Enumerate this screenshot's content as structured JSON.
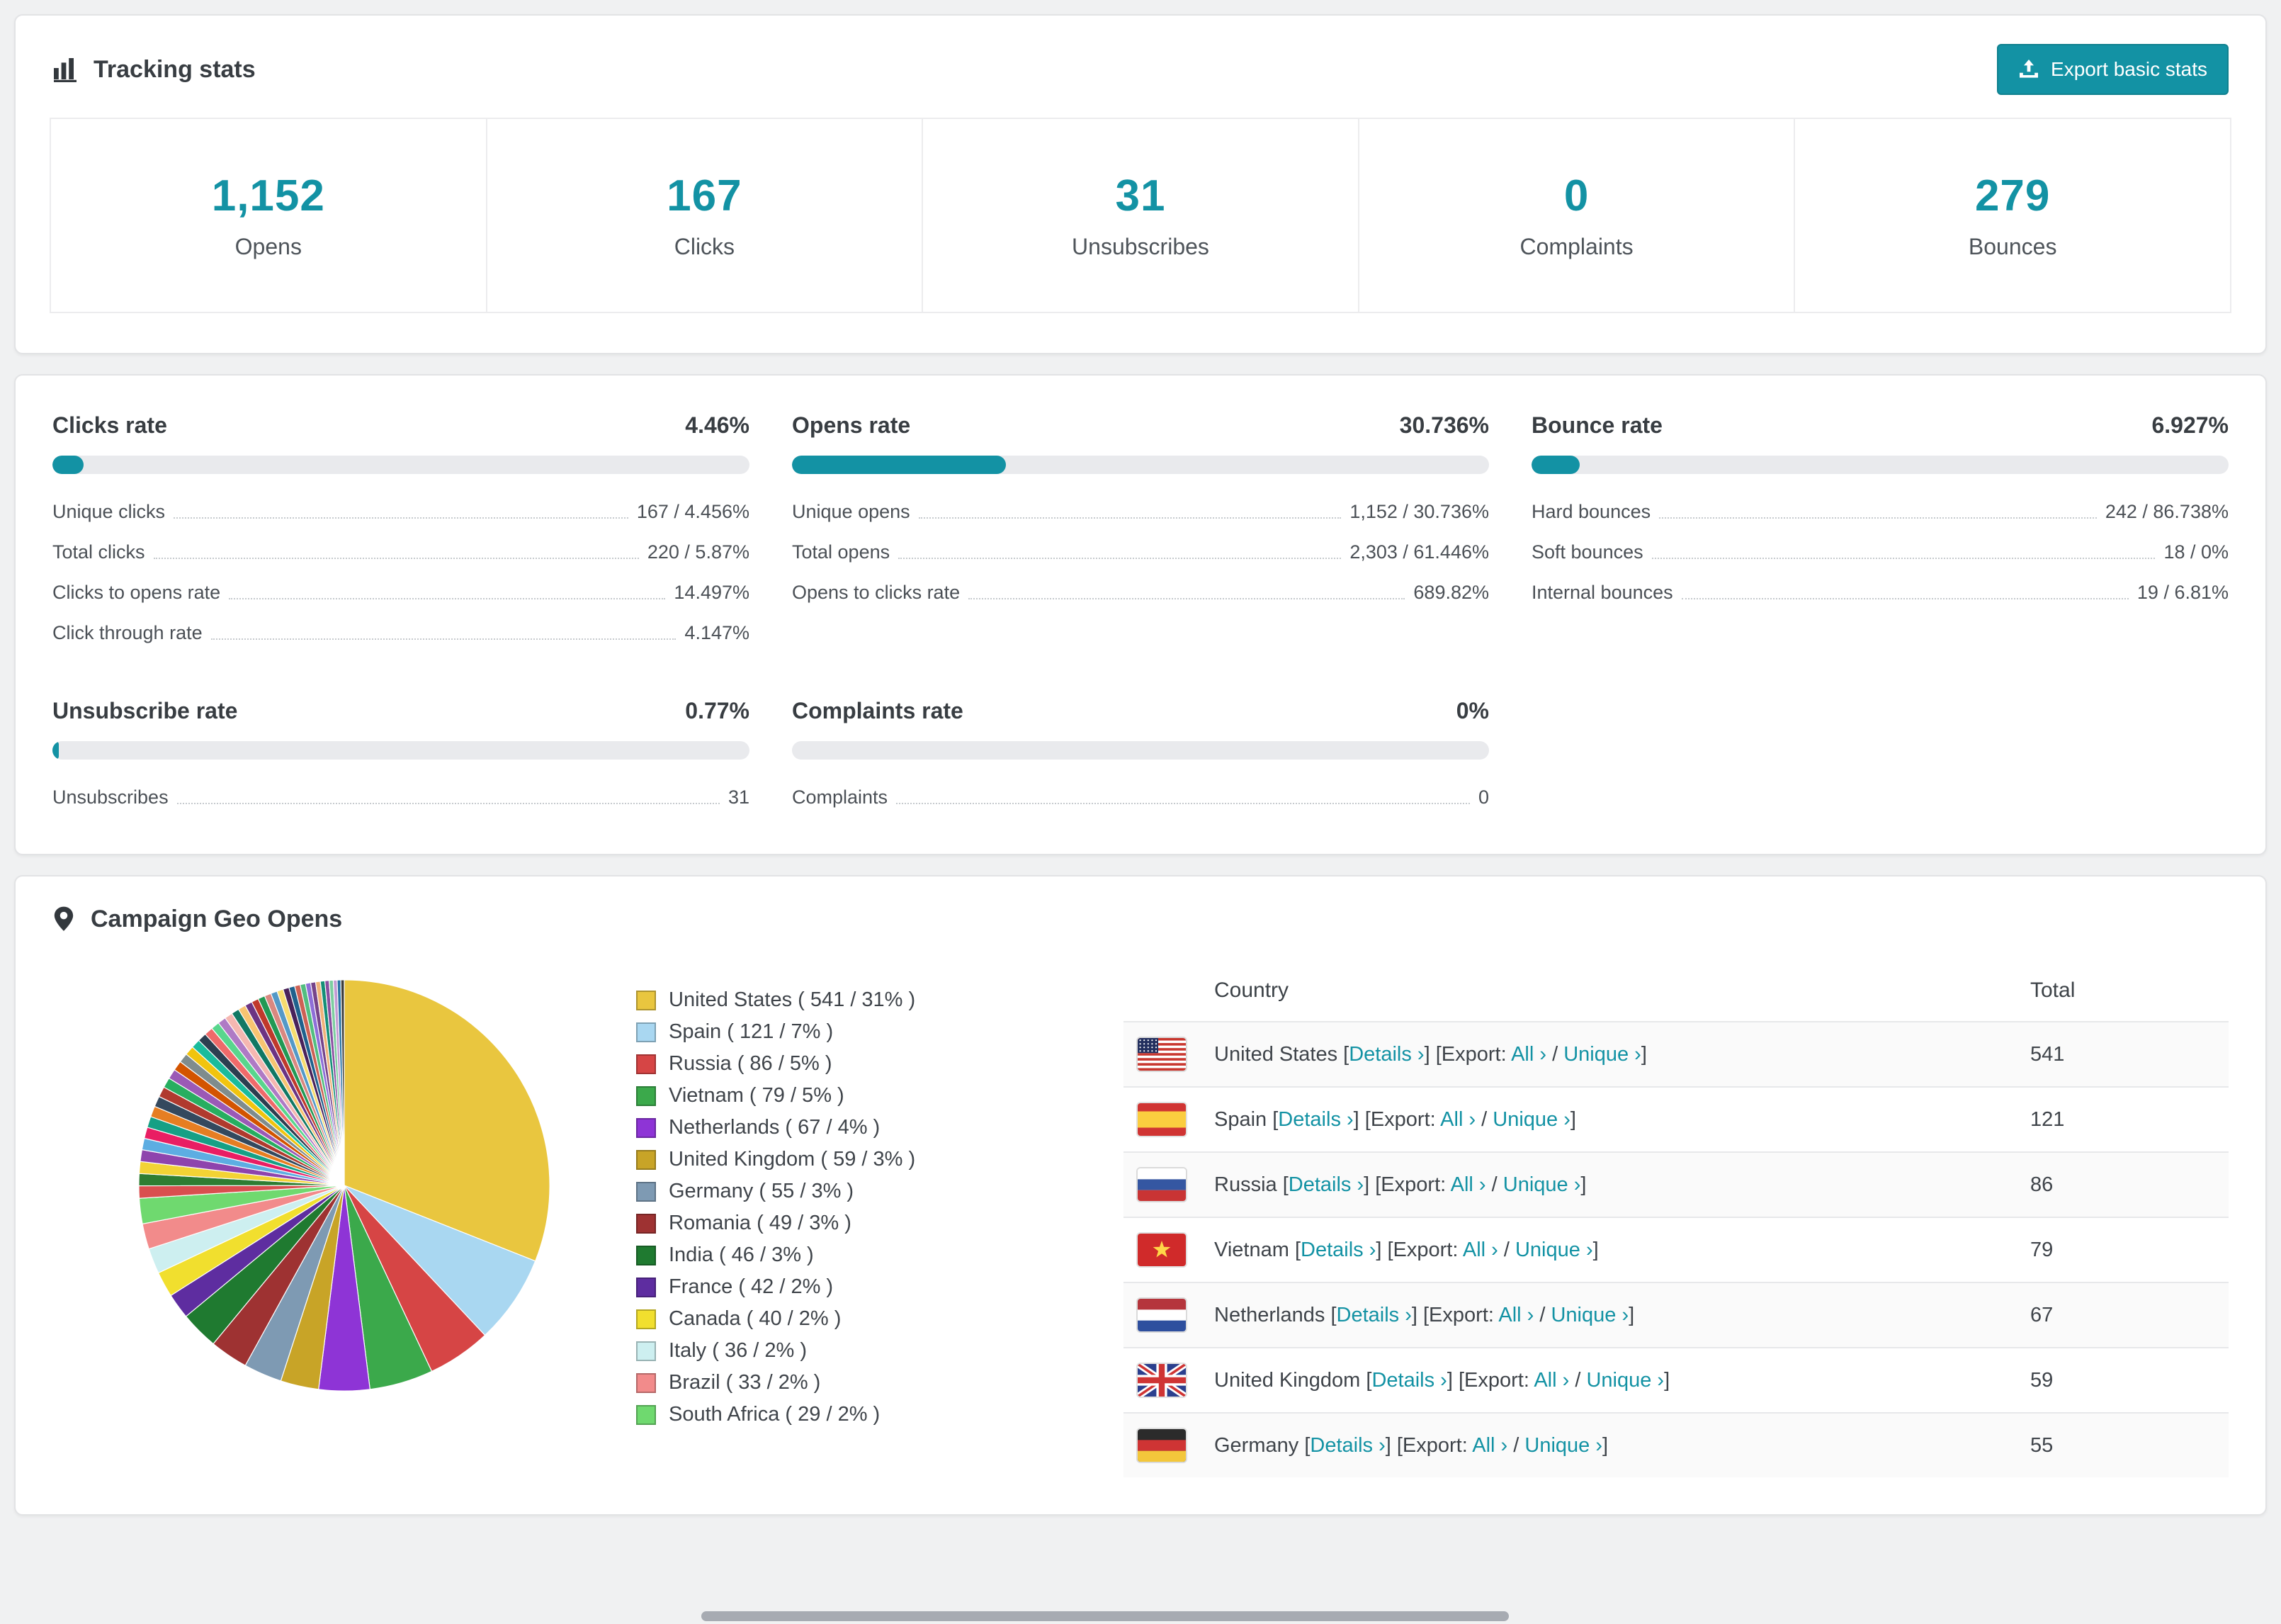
{
  "colors": {
    "accent": "#1392a4",
    "page_bg": "#f0f1f2",
    "progress_track": "#e9eaed"
  },
  "tracking": {
    "title": "Tracking stats",
    "export_label": "Export basic stats",
    "stats": [
      {
        "value": "1,152",
        "label": "Opens"
      },
      {
        "value": "167",
        "label": "Clicks"
      },
      {
        "value": "31",
        "label": "Unsubscribes"
      },
      {
        "value": "0",
        "label": "Complaints"
      },
      {
        "value": "279",
        "label": "Bounces"
      }
    ]
  },
  "rates": [
    {
      "title": "Clicks rate",
      "display": "4.46%",
      "percent": 4.46,
      "rows": [
        {
          "label": "Unique clicks",
          "value": "167 / 4.456%"
        },
        {
          "label": "Total clicks",
          "value": "220 / 5.87%"
        },
        {
          "label": "Clicks to opens rate",
          "value": "14.497%"
        },
        {
          "label": "Click through rate",
          "value": "4.147%"
        }
      ]
    },
    {
      "title": "Opens rate",
      "display": "30.736%",
      "percent": 30.736,
      "rows": [
        {
          "label": "Unique opens",
          "value": "1,152 / 30.736%"
        },
        {
          "label": "Total opens",
          "value": "2,303 / 61.446%"
        },
        {
          "label": "Opens to clicks rate",
          "value": "689.82%"
        }
      ]
    },
    {
      "title": "Bounce rate",
      "display": "6.927%",
      "percent": 6.927,
      "rows": [
        {
          "label": "Hard bounces",
          "value": "242 / 86.738%"
        },
        {
          "label": "Soft bounces",
          "value": "18 / 0%"
        },
        {
          "label": "Internal bounces",
          "value": "19 / 6.81%"
        }
      ]
    },
    {
      "title": "Unsubscribe rate",
      "display": "0.77%",
      "percent": 0.77,
      "rows": [
        {
          "label": "Unsubscribes",
          "value": "31"
        }
      ]
    },
    {
      "title": "Complaints rate",
      "display": "0%",
      "percent": 0,
      "rows": [
        {
          "label": "Complaints",
          "value": "0"
        }
      ]
    }
  ],
  "geo": {
    "title": "Campaign Geo Opens",
    "chart_data": {
      "type": "pie",
      "title": "Campaign Geo Opens",
      "unit": "opens",
      "slices": [
        {
          "name": "United States",
          "count": 541,
          "percent": 31,
          "color": "#e9c63f"
        },
        {
          "name": "Spain",
          "count": 121,
          "percent": 7,
          "color": "#a9d7f1"
        },
        {
          "name": "Russia",
          "count": 86,
          "percent": 5,
          "color": "#d64545"
        },
        {
          "name": "Vietnam",
          "count": 79,
          "percent": 5,
          "color": "#3ba94b"
        },
        {
          "name": "Netherlands",
          "count": 67,
          "percent": 4,
          "color": "#8e34d6"
        },
        {
          "name": "United Kingdom",
          "count": 59,
          "percent": 3,
          "color": "#c8a427"
        },
        {
          "name": "Germany",
          "count": 55,
          "percent": 3,
          "color": "#7e9ab3"
        },
        {
          "name": "Romania",
          "count": 49,
          "percent": 3,
          "color": "#9e3232"
        },
        {
          "name": "India",
          "count": 46,
          "percent": 3,
          "color": "#1f7a30"
        },
        {
          "name": "France",
          "count": 42,
          "percent": 2,
          "color": "#5e2da0"
        },
        {
          "name": "Canada",
          "count": 40,
          "percent": 2,
          "color": "#f1df2e"
        },
        {
          "name": "Italy",
          "count": 36,
          "percent": 2,
          "color": "#cdeff0"
        },
        {
          "name": "Brazil",
          "count": 33,
          "percent": 2,
          "color": "#f28b8b"
        },
        {
          "name": "South Africa",
          "count": 29,
          "percent": 2,
          "color": "#6fd96f"
        }
      ],
      "others_percent": 26,
      "others_slice_count": 42,
      "others_palette": [
        "#d94f4f",
        "#2e7d32",
        "#f2d335",
        "#8e44ad",
        "#5dade2",
        "#e91e63",
        "#16a085",
        "#e67e22",
        "#34495e",
        "#b03a2e",
        "#27ae60",
        "#9b59b6",
        "#d35400",
        "#7f8c8d",
        "#f1c40f",
        "#1abc9c",
        "#2c3e50",
        "#ef6a6a",
        "#58d68d",
        "#af7ac5",
        "#f5b7b1",
        "#117864",
        "#f8c471",
        "#6c3483",
        "#c0392b",
        "#229954",
        "#d98880",
        "#5499c7",
        "#f7dc6f",
        "#4a235a",
        "#1f618d",
        "#cd6155",
        "#52be80",
        "#8e6fd8",
        "#76448a",
        "#f0b27a",
        "#148f77",
        "#884ea0",
        "#7dcea0",
        "#c39bd3",
        "#2874a6",
        "#3d3d3d"
      ],
      "legend_position": "right"
    },
    "table": {
      "headers": [
        "Country",
        "Total"
      ],
      "link_text": {
        "bracket_open": "[",
        "bracket_close": "]",
        "details": "Details ›",
        "export_label": "Export:",
        "all": "All ›",
        "separator": "/",
        "unique": "Unique ›"
      },
      "rows": [
        {
          "flag": "us",
          "country": "United States",
          "total": "541"
        },
        {
          "flag": "es",
          "country": "Spain",
          "total": "121"
        },
        {
          "flag": "ru",
          "country": "Russia",
          "total": "86"
        },
        {
          "flag": "vn",
          "country": "Vietnam",
          "total": "79"
        },
        {
          "flag": "nl",
          "country": "Netherlands",
          "total": "67"
        },
        {
          "flag": "gb",
          "country": "United Kingdom",
          "total": "59"
        },
        {
          "flag": "de",
          "country": "Germany",
          "total": "55"
        }
      ]
    }
  }
}
